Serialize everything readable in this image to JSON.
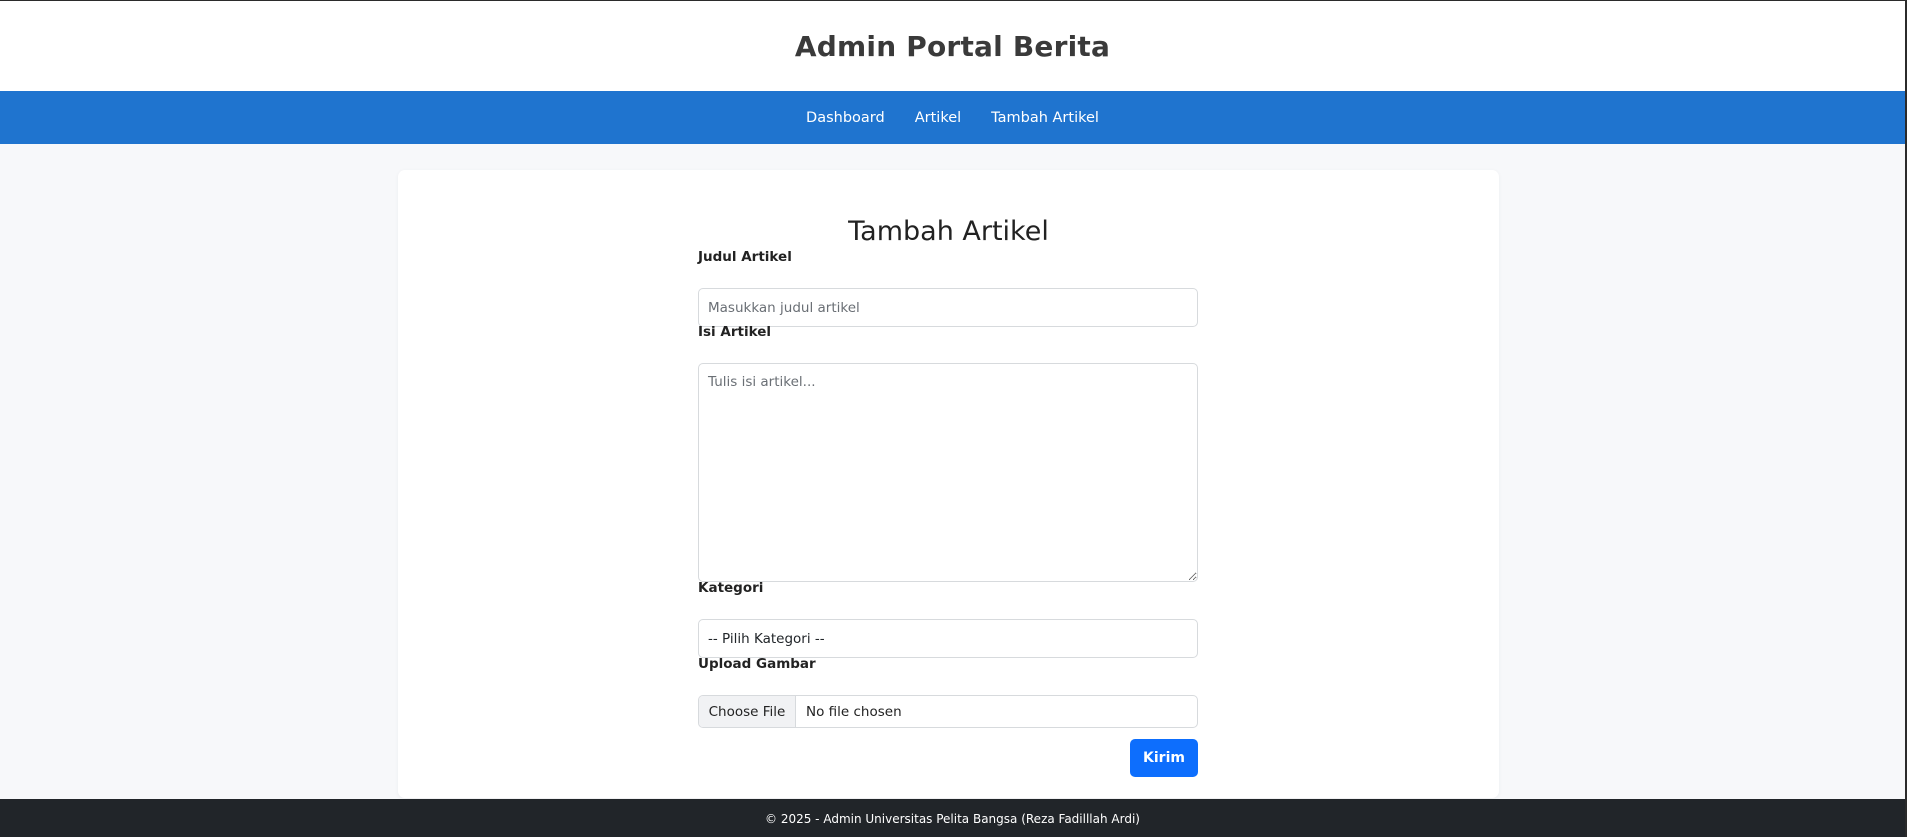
{
  "header": {
    "title": "Admin Portal Berita"
  },
  "nav": {
    "items": [
      {
        "label": "Dashboard"
      },
      {
        "label": "Artikel"
      },
      {
        "label": "Tambah Artikel"
      }
    ]
  },
  "form": {
    "title": "Tambah Artikel",
    "title_field": {
      "label": "Judul Artikel",
      "placeholder": "Masukkan judul artikel",
      "value": ""
    },
    "content_field": {
      "label": "Isi Artikel",
      "placeholder": "Tulis isi artikel...",
      "value": ""
    },
    "category_field": {
      "label": "Kategori",
      "selected": "-- Pilih Kategori --"
    },
    "image_field": {
      "label": "Upload Gambar",
      "button_label": "Choose File",
      "file_status": "No file chosen"
    },
    "submit_label": "Kirim"
  },
  "footer": {
    "text": "© 2025 - Admin Universitas Pelita Bangsa (Reza Fadilllah Ardi)"
  },
  "colors": {
    "nav_background": "#1f74cf",
    "primary_button": "#0d6efd",
    "footer_background": "#212529"
  }
}
